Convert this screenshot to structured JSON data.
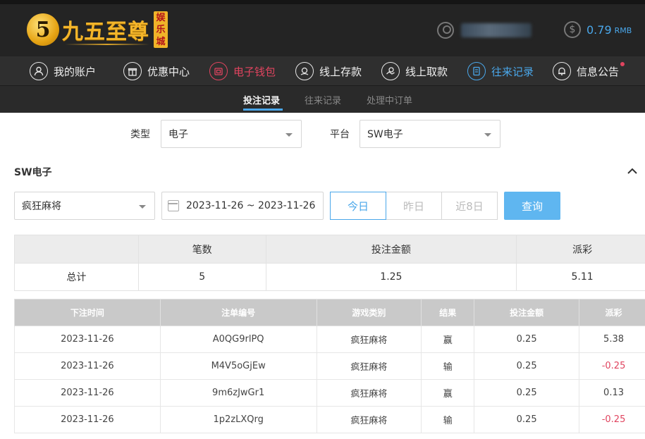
{
  "header": {
    "logo_badge": "5",
    "logo_text": "九五至尊",
    "logo_sub": "娱乐城",
    "balance_amount": "0.79",
    "balance_unit": "RMB"
  },
  "nav": {
    "items": [
      {
        "label": "我的账户",
        "icon": "user-icon"
      },
      {
        "label": "优惠中心",
        "icon": "gift-icon"
      },
      {
        "label": "电子钱包",
        "icon": "wallet-icon"
      },
      {
        "label": "线上存款",
        "icon": "deposit-icon"
      },
      {
        "label": "线上取款",
        "icon": "withdraw-icon"
      },
      {
        "label": "往来记录",
        "icon": "records-icon"
      },
      {
        "label": "信息公告",
        "icon": "bell-icon"
      }
    ]
  },
  "subtabs": [
    "投注记录",
    "往来记录",
    "处理中订单"
  ],
  "filters": {
    "type_label": "类型",
    "type_value": "电子",
    "platform_label": "平台",
    "platform_value": "SW电子"
  },
  "section": {
    "title": "SW电子",
    "game_value": "疯狂麻将",
    "date_range": "2023-11-26 ~ 2023-11-26",
    "quick": [
      "今日",
      "昨日",
      "近8日"
    ],
    "query_label": "查询"
  },
  "summary": {
    "headers": [
      "",
      "笔数",
      "投注金额",
      "派彩"
    ],
    "row": [
      "总计",
      "5",
      "1.25",
      "5.11"
    ]
  },
  "detail": {
    "headers": [
      "下注时间",
      "注单编号",
      "游戏类别",
      "结果",
      "投注金额",
      "派彩"
    ],
    "rows": [
      [
        "2023-11-26",
        "A0QG9rlPQ",
        "疯狂麻将",
        "赢",
        "0.25",
        "5.38"
      ],
      [
        "2023-11-26",
        "M4V5oGjEw",
        "疯狂麻将",
        "输",
        "0.25",
        "-0.25"
      ],
      [
        "2023-11-26",
        "9m6zJwGr1",
        "疯狂麻将",
        "赢",
        "0.25",
        "0.13"
      ],
      [
        "2023-11-26",
        "1p2zLXQrg",
        "疯狂麻将",
        "输",
        "0.25",
        "-0.25"
      ]
    ]
  },
  "colors": {
    "accent": "#4aa7ea",
    "wallet": "#e0445f",
    "negative": "#e0445f"
  }
}
